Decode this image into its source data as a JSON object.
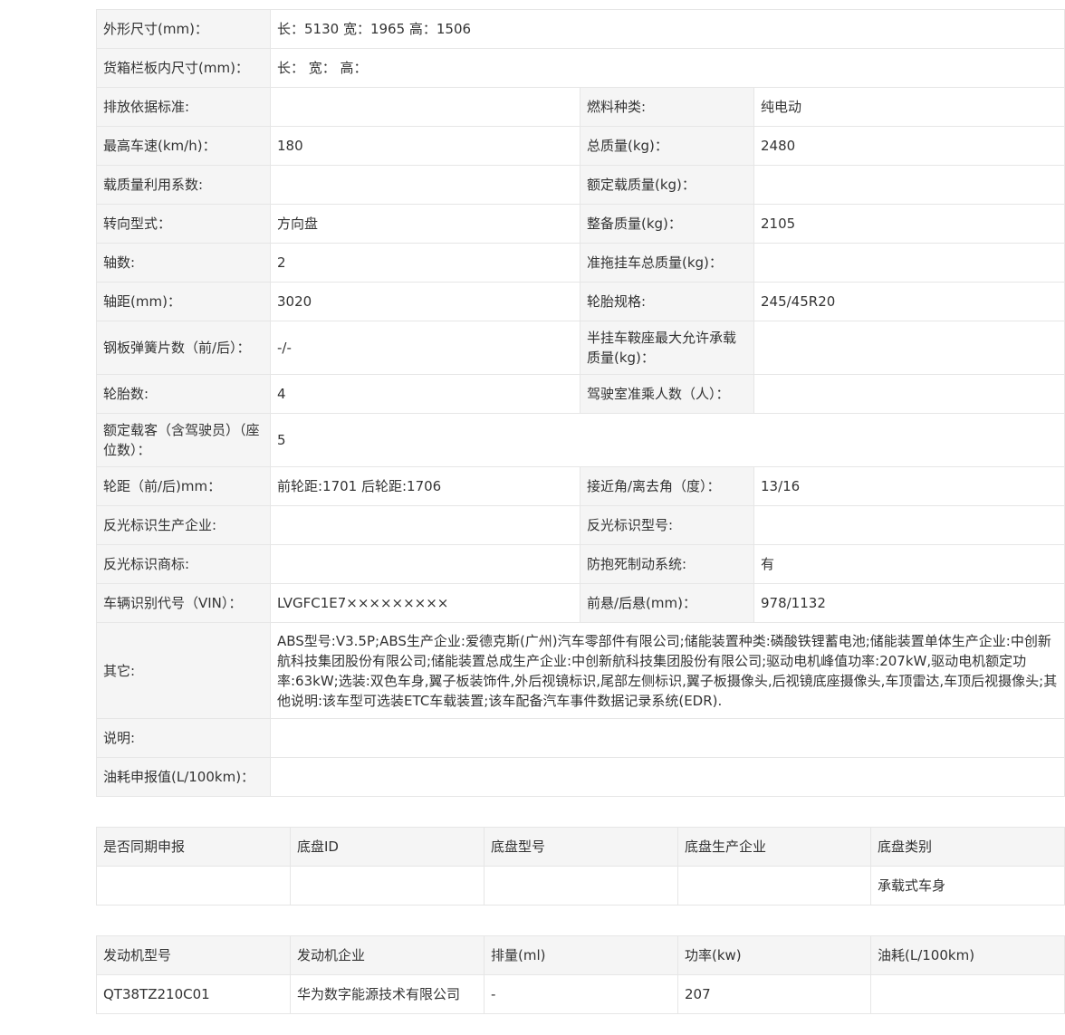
{
  "spec": {
    "dimensions_label": "外形尺寸(mm)：",
    "dimensions_value": "长：5130 宽：1965 高：1506",
    "cargo_label": "货箱栏板内尺寸(mm)：",
    "cargo_value": "长： 宽： 高：",
    "pairs": [
      [
        "排放依据标准:",
        "",
        "燃料种类:",
        "纯电动"
      ],
      [
        "最高车速(km/h)：",
        "180",
        "总质量(kg)：",
        "2480"
      ],
      [
        "载质量利用系数:",
        "",
        "额定载质量(kg)：",
        ""
      ],
      [
        "转向型式：",
        "方向盘",
        "整备质量(kg)：",
        "2105"
      ],
      [
        "轴数:",
        "2",
        "准拖挂车总质量(kg)：",
        ""
      ],
      [
        "轴距(mm)：",
        "3020",
        "轮胎规格:",
        "245/45R20"
      ],
      [
        "钢板弹簧片数（前/后）：",
        "-/-",
        "半挂车鞍座最大允许承载质量(kg)：",
        ""
      ],
      [
        "轮胎数:",
        "4",
        "驾驶室准乘人数（人）：",
        ""
      ]
    ],
    "passengers_label": "额定载客（含驾驶员）（座位数）：",
    "passengers_value": "5",
    "pairs2": [
      [
        "轮距（前/后)mm：",
        "前轮距:1701 后轮距:1706",
        "接近角/离去角（度）：",
        "13/16"
      ],
      [
        "反光标识生产企业:",
        "",
        "反光标识型号:",
        ""
      ],
      [
        "反光标识商标:",
        "",
        "防抱死制动系统:",
        "有"
      ],
      [
        "车辆识别代号（VIN）：",
        "LVGFC1E7×××××××××",
        "前悬/后悬(mm)：",
        "978/1132"
      ]
    ],
    "other_label": "其它:",
    "other_value": "ABS型号:V3.5P;ABS生产企业:爱德克斯(广州)汽车零部件有限公司;储能装置种类:磷酸铁锂蓄电池;储能装置单体生产企业:中创新航科技集团股份有限公司;储能装置总成生产企业:中创新航科技集团股份有限公司;驱动电机峰值功率:207kW,驱动电机额定功率:63kW;选装:双色车身,翼子板装饰件,外后视镜标识,尾部左侧标识,翼子板摄像头,后视镜底座摄像头,车顶雷达,车顶后视摄像头;其他说明:该车型可选装ETC车载装置;该车配备汽车事件数据记录系统(EDR).",
    "note_label": "说明:",
    "note_value": "",
    "fuel_label": "油耗申报值(L/100km)：",
    "fuel_value": ""
  },
  "chassis": {
    "headers": [
      "是否同期申报",
      "底盘ID",
      "底盘型号",
      "底盘生产企业",
      "底盘类别"
    ],
    "row": [
      "",
      "",
      "",
      "",
      "承载式车身"
    ]
  },
  "engine": {
    "headers": [
      "发动机型号",
      "发动机企业",
      "排量(ml)",
      "功率(kw)",
      "油耗(L/100km)"
    ],
    "row": [
      "QT38TZ210C01",
      "华为数字能源技术有限公司",
      "-",
      "207",
      ""
    ]
  }
}
